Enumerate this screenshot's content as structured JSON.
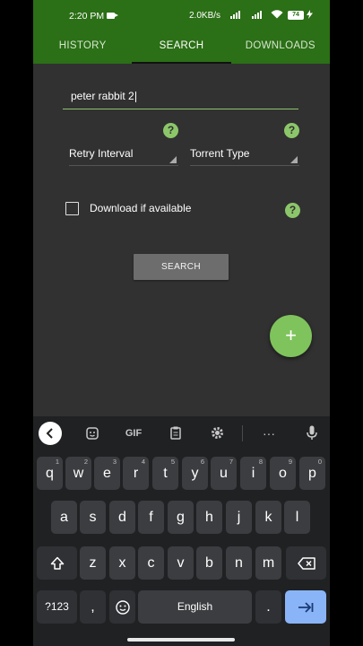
{
  "status_bar": {
    "time": "2:20 PM",
    "speed": "2.0KB/s",
    "battery": "74"
  },
  "tabs": [
    {
      "label": "HISTORY",
      "active": false
    },
    {
      "label": "SEARCH",
      "active": true
    },
    {
      "label": "DOWNLOADS",
      "active": false
    }
  ],
  "form": {
    "query_value": "peter rabbit 2",
    "retry_interval_label": "Retry Interval",
    "torrent_type_label": "Torrent Type",
    "download_if_available_label": "Download if available",
    "download_if_available_checked": false,
    "search_button_label": "SEARCH",
    "help_glyph": "?",
    "fab_glyph": "+"
  },
  "keyboard": {
    "toolbar": {
      "gif_label": "GIF"
    },
    "row1": [
      {
        "key": "q",
        "hint": "1"
      },
      {
        "key": "w",
        "hint": "2"
      },
      {
        "key": "e",
        "hint": "3"
      },
      {
        "key": "r",
        "hint": "4"
      },
      {
        "key": "t",
        "hint": "5"
      },
      {
        "key": "y",
        "hint": "6"
      },
      {
        "key": "u",
        "hint": "7"
      },
      {
        "key": "i",
        "hint": "8"
      },
      {
        "key": "o",
        "hint": "9"
      },
      {
        "key": "p",
        "hint": "0"
      }
    ],
    "row2": [
      "a",
      "s",
      "d",
      "f",
      "g",
      "h",
      "j",
      "k",
      "l"
    ],
    "row3": [
      "z",
      "x",
      "c",
      "v",
      "b",
      "n",
      "m"
    ],
    "symbols_label": "?123",
    "comma_label": ",",
    "space_label": "English",
    "period_label": "."
  },
  "colors": {
    "app_bar": "#2b6f16",
    "accent": "#8cc66a",
    "background": "#313131",
    "keyboard_bg": "#202123",
    "enter_key": "#8ab4f8"
  },
  "icons": {
    "toolbar": [
      "back-arrow-icon",
      "sticker-icon",
      "gif-icon",
      "clipboard-icon",
      "settings-icon",
      "more-icon",
      "microphone-icon"
    ],
    "shift": "shift-icon",
    "backspace": "backspace-icon",
    "emoji": "emoji-icon",
    "enter": "tab-enter-icon",
    "fab": "add-icon",
    "help": "help-icon"
  }
}
